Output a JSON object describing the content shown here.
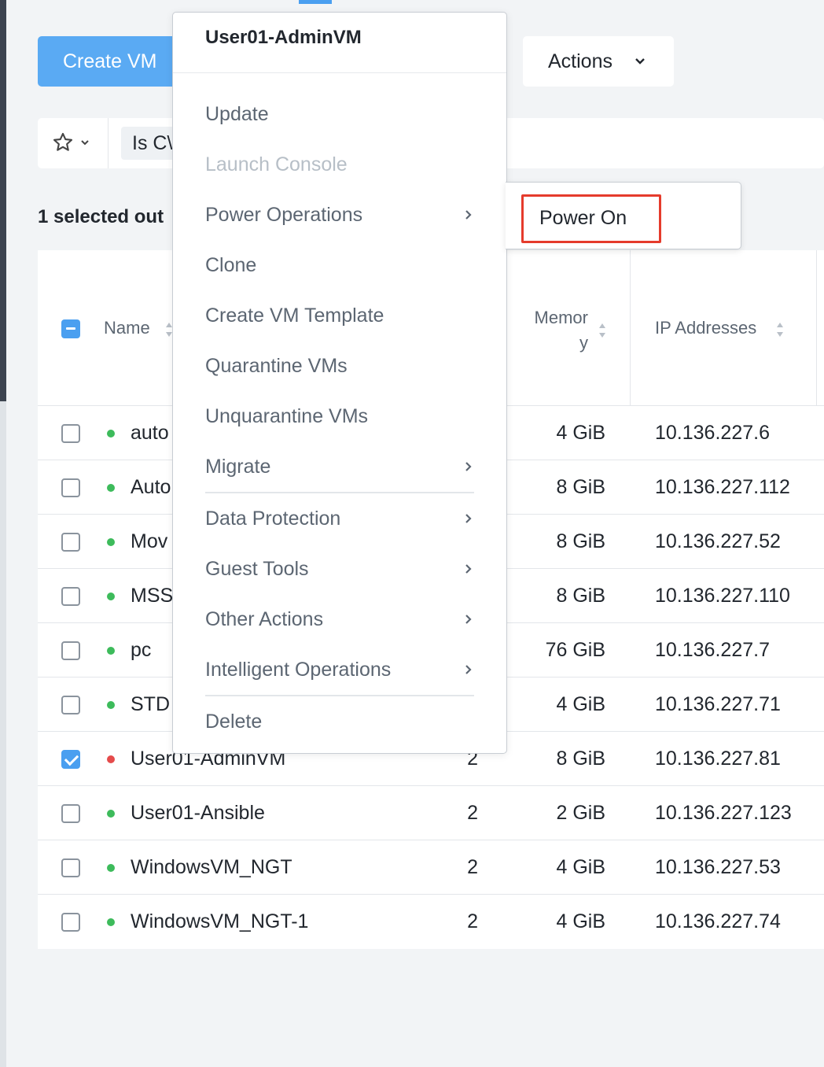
{
  "toolbar": {
    "create_vm_label": "Create VM",
    "actions_label": "Actions",
    "actions_chevron": "❯"
  },
  "filter": {
    "favorites_icon": "star-icon",
    "chip_text": "Is C\\"
  },
  "selection": {
    "summary": "1 selected out"
  },
  "table": {
    "headers": {
      "name": "Name",
      "memory_line1": "Memor",
      "memory_line2": "y",
      "ip": "IP Addresses"
    },
    "rows": [
      {
        "name": "auto",
        "vcpu": "",
        "memory": "4 GiB",
        "ip": "10.136.227.6",
        "status": "on",
        "selected": false
      },
      {
        "name": "Auto",
        "vcpu": "",
        "memory": "8 GiB",
        "ip": "10.136.227.112",
        "status": "on",
        "selected": false
      },
      {
        "name": "Mov",
        "vcpu": "",
        "memory": "8 GiB",
        "ip": "10.136.227.52",
        "status": "on",
        "selected": false
      },
      {
        "name": "MSS",
        "vcpu": "",
        "memory": "8 GiB",
        "ip": "10.136.227.110",
        "status": "on",
        "selected": false
      },
      {
        "name": "pc",
        "vcpu": "",
        "memory": "76 GiB",
        "ip": "10.136.227.7",
        "status": "on",
        "selected": false
      },
      {
        "name": "STD",
        "vcpu": "",
        "memory": "4 GiB",
        "ip": "10.136.227.71",
        "status": "on",
        "selected": false
      },
      {
        "name": "User01-AdminVM",
        "vcpu": "2",
        "memory": "8 GiB",
        "ip": "10.136.227.81",
        "status": "off",
        "selected": true
      },
      {
        "name": "User01-Ansible",
        "vcpu": "2",
        "memory": "2 GiB",
        "ip": "10.136.227.123",
        "status": "on",
        "selected": false
      },
      {
        "name": "WindowsVM_NGT",
        "vcpu": "2",
        "memory": "4 GiB",
        "ip": "10.136.227.53",
        "status": "on",
        "selected": false
      },
      {
        "name": "WindowsVM_NGT-1",
        "vcpu": "2",
        "memory": "4 GiB",
        "ip": "10.136.227.74",
        "status": "on",
        "selected": false
      }
    ]
  },
  "context_menu": {
    "title": "User01-AdminVM",
    "items": [
      {
        "label": "Update",
        "disabled": false,
        "submenu": false
      },
      {
        "label": "Launch Console",
        "disabled": true,
        "submenu": false
      },
      {
        "label": "Power Operations",
        "disabled": false,
        "submenu": true
      },
      {
        "label": "Clone",
        "disabled": false,
        "submenu": false
      },
      {
        "label": "Create VM Template",
        "disabled": false,
        "submenu": false
      },
      {
        "label": "Quarantine VMs",
        "disabled": false,
        "submenu": false
      },
      {
        "label": "Unquarantine VMs",
        "disabled": false,
        "submenu": false
      },
      {
        "label": "Migrate",
        "disabled": false,
        "submenu": true
      },
      {
        "label": "Data Protection",
        "disabled": false,
        "submenu": true
      },
      {
        "label": "Guest Tools",
        "disabled": false,
        "submenu": true
      },
      {
        "label": "Other Actions",
        "disabled": false,
        "submenu": true
      },
      {
        "label": "Intelligent Operations",
        "disabled": false,
        "submenu": true
      },
      {
        "label": "Delete",
        "disabled": false,
        "submenu": false
      }
    ],
    "arrow_glyph": "›"
  },
  "power_submenu": {
    "items": [
      {
        "label": "Power On",
        "highlighted": true
      }
    ]
  },
  "colors": {
    "accent": "#4a9ff0",
    "primary_button": "#5aaaf3",
    "status_on": "#3dbb5b",
    "status_off": "#e54b4b",
    "highlight_box": "#e53b2c"
  }
}
